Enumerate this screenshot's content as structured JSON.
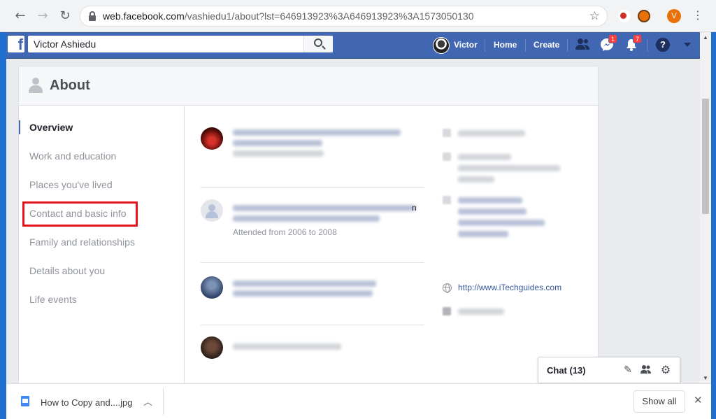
{
  "browser": {
    "url_host": "web.facebook.com",
    "url_path": "/vashiedu1/about?lst=646913923%3A646913923%3A1573050130",
    "profile_initial": "V"
  },
  "fb": {
    "search_value": "Victor Ashiedu",
    "user_name": "Victor",
    "home_label": "Home",
    "create_label": "Create",
    "messenger_badge": "1",
    "notifications_badge": "7",
    "help_label": "?"
  },
  "about": {
    "title": "About",
    "nav": [
      {
        "label": "Overview"
      },
      {
        "label": "Work and education"
      },
      {
        "label": "Places you've lived"
      },
      {
        "label": "Contact and basic info"
      },
      {
        "label": "Family and relationships"
      },
      {
        "label": "Details about you"
      },
      {
        "label": "Life events"
      }
    ],
    "education_sub": "Attended from 2006 to 2008",
    "education_tail": "n",
    "website": "http://www.iTechguides.com"
  },
  "chat": {
    "label": "Chat (13)"
  },
  "downloads": {
    "file_name": "How to Copy and....jpg",
    "show_all": "Show all"
  }
}
